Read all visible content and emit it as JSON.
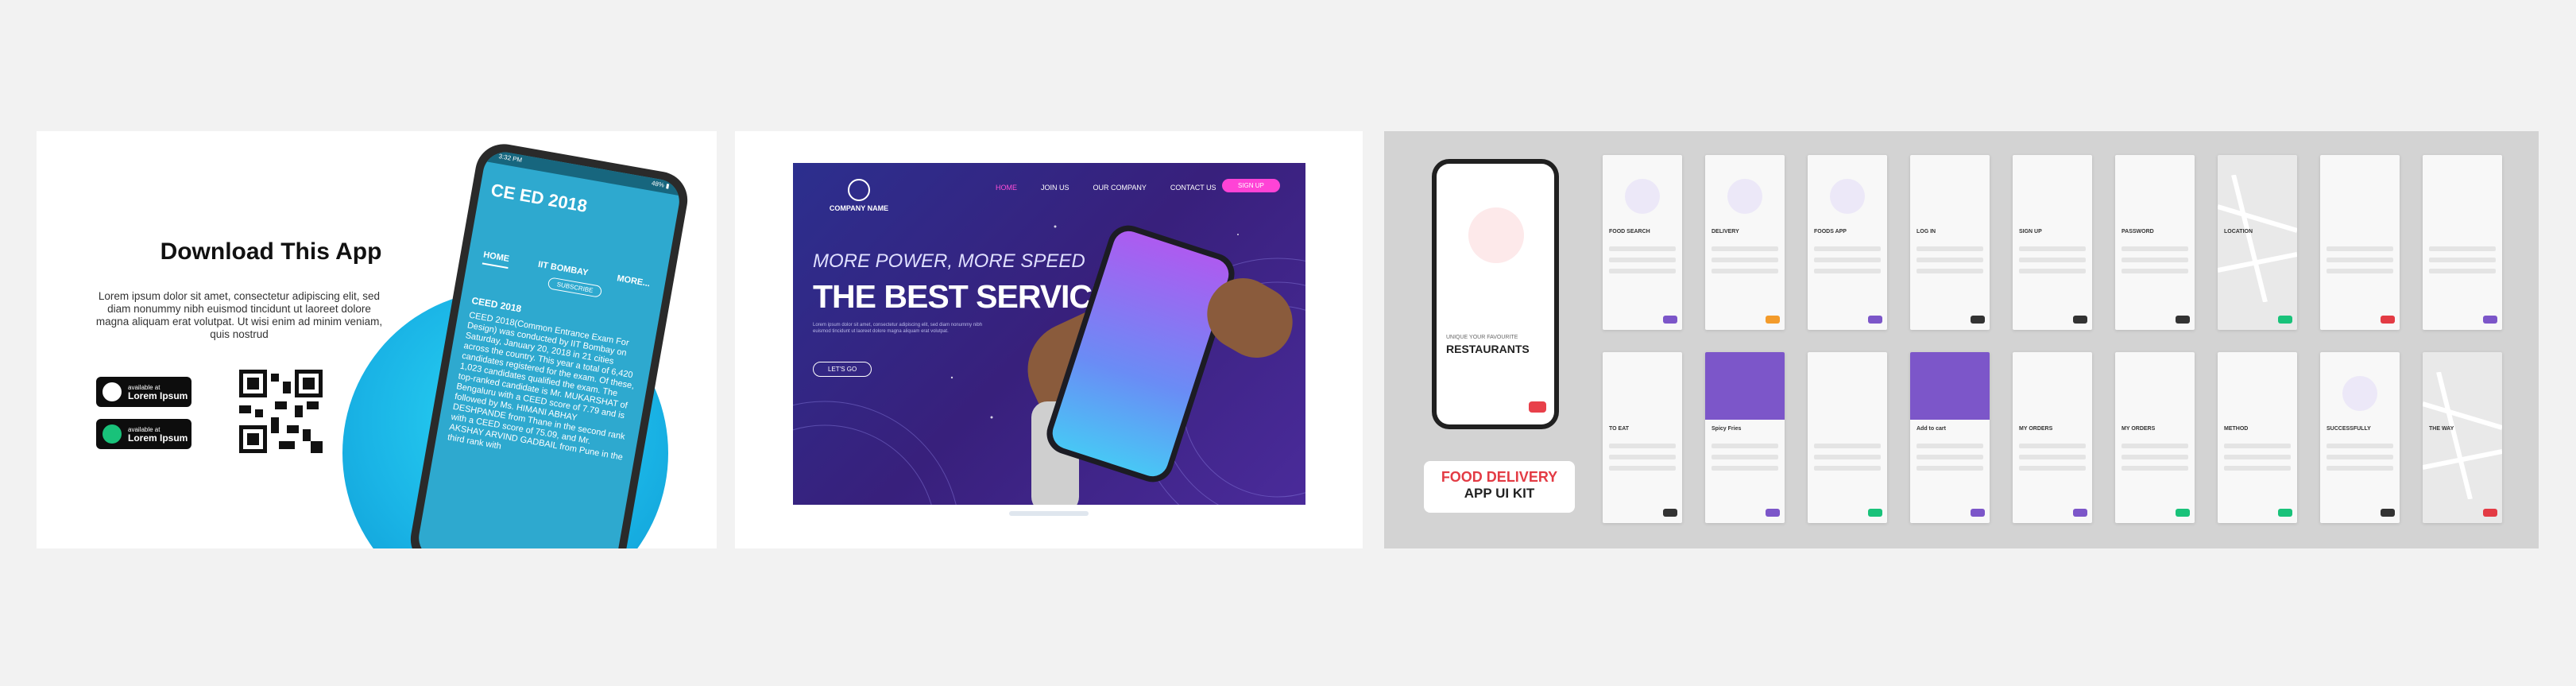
{
  "card1": {
    "title": "Download This App",
    "description": "Lorem ipsum dolor sit amet, consectetur adipiscing elit, sed diam nonummy nibh euismod tincidunt ut laoreet dolore magna aliquam erat volutpat. Ut wisi enim ad minim veniam, quis nostrud",
    "store_buttons": [
      {
        "small": "available at",
        "big": "Lorem Ipsum",
        "dot_color": "#ffffff"
      },
      {
        "small": "available at",
        "big": "Lorem Ipsum",
        "dot_color": "#19c27a"
      }
    ],
    "phone": {
      "status_time": "3:32 PM",
      "status_right": "48% ▮",
      "brand": "CE ED 2018",
      "subscribe": "SUBSCRIBE",
      "nav": [
        "HOME",
        "IIT BOMBAY",
        "MORE..."
      ],
      "section": "CEED 2018",
      "body": "CEED 2018(Common Entrance Exam For Design) was conducted by IIT Bombay on Saturday, January 20, 2018 in 21 cities across the country. This year a total of 6,420 candidates registered for the exam. Of these, 1,023 candidates qualified the exam. The top-ranked candidate is Mr. MUKARSHAT of Bengaluru with a CEED score of 7.79 and is followed by Ms. HIMANI ABHAY DESHPANDE from Thane in the second rank with a CEED score of 75.09, and Mr. AKSHAY ARVIND GADBAIL from Pune in the third rank with"
    }
  },
  "card2": {
    "company": "COMPANY NAME",
    "menu": [
      "HOME",
      "JOIN US",
      "OUR COMPANY",
      "CONTACT US"
    ],
    "signup": "SIGN UP",
    "headline_small": "MORE POWER, MORE SPEED",
    "headline_big": "THE BEST SERVICE",
    "lorem": "Lorem ipsum dolor sit amet, consectetur adipiscing elit, sed diam nonummy nibh euismod tincidunt ut laoreet dolore magna aliquam erat volutpat.",
    "cta": "LET'S GO",
    "accent": "#ff43d6"
  },
  "card3": {
    "main_phone": {
      "small": "UNIQUE YOUR FAVOURITE",
      "title": "RESTAURANTS"
    },
    "kit_label_line1": "FOOD DELIVERY",
    "kit_label_line2": "APP UI KIT",
    "accent": "#e33b44",
    "screens": [
      {
        "kind": "illu",
        "title": "FOOD SEARCH",
        "cta": "#7c56c9"
      },
      {
        "kind": "illu",
        "title": "DELIVERY",
        "cta": "#f39b2b"
      },
      {
        "kind": "illu",
        "title": "FOODS APP",
        "cta": "#7c56c9"
      },
      {
        "kind": "form",
        "title": "LOG IN",
        "cta": "#333333"
      },
      {
        "kind": "form",
        "title": "SIGN UP",
        "cta": "#333333"
      },
      {
        "kind": "form",
        "title": "PASSWORD",
        "cta": "#333333"
      },
      {
        "kind": "map",
        "title": "LOCATION",
        "cta": "#19c27a"
      },
      {
        "kind": "form",
        "title": "",
        "cta": "#e33b44"
      },
      {
        "kind": "form",
        "title": "",
        "cta": "#7c56c9"
      },
      {
        "kind": "form",
        "title": "TO EAT",
        "cta": "#333333"
      },
      {
        "kind": "purple",
        "title": "Spicy Fries",
        "cta": "#7c56c9"
      },
      {
        "kind": "form",
        "title": "",
        "cta": "#19c27a"
      },
      {
        "kind": "purple",
        "title": "Add to cart",
        "cta": "#7c56c9"
      },
      {
        "kind": "form",
        "title": "MY ORDERS",
        "cta": "#7c56c9"
      },
      {
        "kind": "form",
        "title": "MY ORDERS",
        "cta": "#19c27a"
      },
      {
        "kind": "form",
        "title": "METHOD",
        "cta": "#19c27a"
      },
      {
        "kind": "illu",
        "title": "SUCCESSFULLY",
        "cta": "#333333"
      },
      {
        "kind": "map",
        "title": "THE WAY",
        "cta": "#e33b44"
      }
    ]
  }
}
